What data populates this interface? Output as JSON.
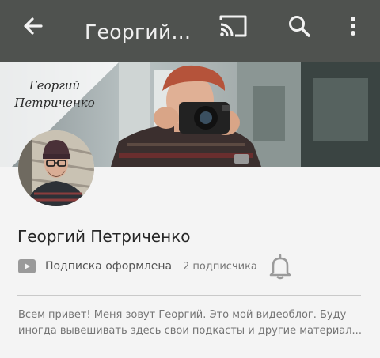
{
  "appbar": {
    "title": "Георгий...",
    "back_icon": "arrow-back-icon",
    "cast_icon": "cast-icon",
    "search_icon": "search-icon",
    "more_icon": "more-vert-icon",
    "background": "#4f524f"
  },
  "banner": {
    "caption_line1": "Георгий",
    "caption_line2": "Петриченко"
  },
  "channel": {
    "name": "Георгий Петриченко",
    "subscription_status": "Подписка оформлена",
    "subscriber_count": "2 подписчика",
    "description_line1": "Всем привет! Меня зовут Георгий. Это мой видеоблог. Буду",
    "description_line2": "иногда вывешивать здесь свои подкасты и другие материал..."
  },
  "icons": {
    "youtube": "youtube-icon",
    "bell": "bell-icon"
  }
}
